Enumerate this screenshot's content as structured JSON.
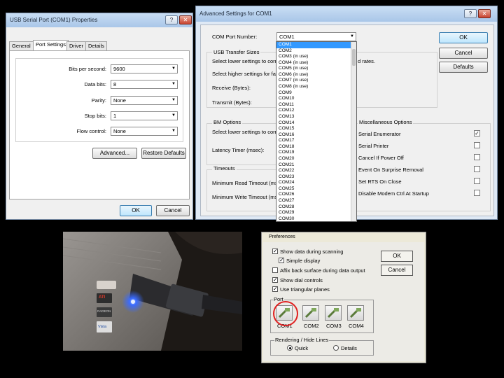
{
  "props_window": {
    "title": "USB Serial Port (COM1) Properties",
    "tabs": [
      "General",
      "Port Settings",
      "Driver",
      "Details"
    ],
    "fields": [
      {
        "label": "Bits per second:",
        "value": "9600"
      },
      {
        "label": "Data bits:",
        "value": "8"
      },
      {
        "label": "Parity:",
        "value": "None"
      },
      {
        "label": "Stop bits:",
        "value": "1"
      },
      {
        "label": "Flow control:",
        "value": "None"
      }
    ],
    "advanced_label": "Advanced...",
    "restore_label": "Restore Defaults",
    "ok_label": "OK",
    "cancel_label": "Cancel",
    "help_label": "?",
    "close_label": "✕"
  },
  "adv_window": {
    "title": "Advanced Settings for COM1",
    "com_port_label": "COM Port Number:",
    "com_port_value": "COM1",
    "usb_transfer": "USB Transfer Sizes",
    "select_lower_1": "Select lower settings to corre",
    "rates_suffix": "d rates.",
    "select_higher": "Select higher settings for fas",
    "receive": "Receive (Bytes):",
    "transmit": "Transmit (Bytes):",
    "bm_options": "BM Options",
    "select_lower_2": "Select lower settings to corre",
    "latency": "Latency Timer (msec):",
    "timeouts": "Timeouts",
    "min_read": "Minimum Read Timeout (mse",
    "min_write": "Minimum Write Timeout (mse",
    "misc_title": "Miscellaneous Options",
    "misc": [
      {
        "label": "Serial Enumerator",
        "checked": true
      },
      {
        "label": "Serial Printer",
        "checked": false
      },
      {
        "label": "Cancel If Power Off",
        "checked": false
      },
      {
        "label": "Event On Surprise Removal",
        "checked": false
      },
      {
        "label": "Set RTS On Close",
        "checked": false
      },
      {
        "label": "Disable Modem Ctrl At Startup",
        "checked": false
      }
    ],
    "ok_label": "OK",
    "cancel_label": "Cancel",
    "defaults_label": "Defaults",
    "help_label": "?",
    "close_label": "✕",
    "dropdown": [
      "COM1",
      "COM2",
      "COM3 (in use)",
      "COM4 (in use)",
      "COM5 (in use)",
      "COM6 (in use)",
      "COM7 (in use)",
      "COM8 (in use)",
      "COM9",
      "COM10",
      "COM11",
      "COM12",
      "COM13",
      "COM14",
      "COM15",
      "COM16",
      "COM17",
      "COM18",
      "COM19",
      "COM20",
      "COM21",
      "COM22",
      "COM23",
      "COM24",
      "COM25",
      "COM26",
      "COM27",
      "COM28",
      "COM29",
      "COM30"
    ]
  },
  "photo": {
    "badges": [
      "ATI",
      "RADEON",
      "Vista"
    ]
  },
  "prefs_window": {
    "title": "Preferences",
    "options": [
      {
        "label": "Show data during scanning",
        "checked": true
      },
      {
        "label": "Simple display",
        "checked": true
      },
      {
        "label": "Affix back surface during data output",
        "checked": false
      },
      {
        "label": "Show dial controls",
        "checked": true
      },
      {
        "label": "Use triangular planes",
        "checked": true
      }
    ],
    "port_group": "Port",
    "ports": [
      "COM1",
      "COM2",
      "COM3",
      "COM4"
    ],
    "rendering_group": "Rendering / Hide Lines",
    "render_options": [
      {
        "label": "Quick",
        "selected": true
      },
      {
        "label": "Details",
        "selected": false
      }
    ],
    "ok_label": "OK",
    "cancel_label": "Cancel"
  },
  "colors": {
    "selection": "#3399ff",
    "highlight_circle": "#e02020",
    "led": "#3a6bff"
  }
}
